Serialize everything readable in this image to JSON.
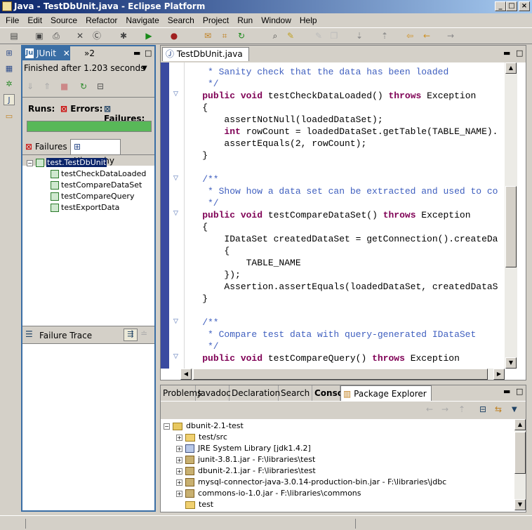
{
  "window": {
    "title": "Java - TestDbUnit.java - Eclipse Platform"
  },
  "menu": [
    "File",
    "Edit",
    "Source",
    "Refactor",
    "Navigate",
    "Search",
    "Project",
    "Run",
    "Window",
    "Help"
  ],
  "junit": {
    "tab_label": "JUnit",
    "overflow_label": "»2",
    "status": "Finished after 1.203 seconds",
    "runs_label": "Runs:",
    "errors_label": "Errors:",
    "failures_label": "Failures:",
    "progress_fraction": 1.0,
    "progress_color": "#58b858",
    "tabs": [
      "Failures",
      "Hierarchy"
    ],
    "tree_root": "test.TestDbUnit",
    "tests": [
      "testCheckDataLoaded",
      "testCompareDataSet",
      "testCompareQuery",
      "testExportData"
    ],
    "failure_trace_label": "Failure Trace"
  },
  "editor": {
    "tab_label": "TestDbUnit.java",
    "lines": [
      [
        {
          "t": "     * Sanity check that the data has been loaded",
          "c": "cmt"
        }
      ],
      [
        {
          "t": "     */",
          "c": "cmt"
        }
      ],
      [
        {
          "t": "    ",
          "c": ""
        },
        {
          "t": "public void",
          "c": "kw"
        },
        {
          "t": " testCheckDataLoaded() ",
          "c": ""
        },
        {
          "t": "throws",
          "c": "kw"
        },
        {
          "t": " Exception",
          "c": ""
        }
      ],
      [
        {
          "t": "    {",
          "c": ""
        }
      ],
      [
        {
          "t": "        assertNotNull(loadedDataSet);",
          "c": ""
        }
      ],
      [
        {
          "t": "        ",
          "c": ""
        },
        {
          "t": "int",
          "c": "kw"
        },
        {
          "t": " rowCount = loadedDataSet.getTable(TABLE_NAME).",
          "c": ""
        }
      ],
      [
        {
          "t": "        assertEquals(2, rowCount);",
          "c": ""
        }
      ],
      [
        {
          "t": "    }",
          "c": ""
        }
      ],
      [
        {
          "t": "",
          "c": ""
        }
      ],
      [
        {
          "t": "    /**",
          "c": "cmt"
        }
      ],
      [
        {
          "t": "     * Show how a data set can be extracted and used to co",
          "c": "cmt"
        }
      ],
      [
        {
          "t": "     */",
          "c": "cmt"
        }
      ],
      [
        {
          "t": "    ",
          "c": ""
        },
        {
          "t": "public void",
          "c": "kw"
        },
        {
          "t": " testCompareDataSet() ",
          "c": ""
        },
        {
          "t": "throws",
          "c": "kw"
        },
        {
          "t": " Exception",
          "c": ""
        }
      ],
      [
        {
          "t": "    {",
          "c": ""
        }
      ],
      [
        {
          "t": "        IDataSet createdDataSet = getConnection().createDa",
          "c": ""
        }
      ],
      [
        {
          "t": "        {",
          "c": ""
        }
      ],
      [
        {
          "t": "            TABLE_NAME",
          "c": ""
        }
      ],
      [
        {
          "t": "        });",
          "c": ""
        }
      ],
      [
        {
          "t": "        Assertion.assertEquals(loadedDataSet, createdDataS",
          "c": ""
        }
      ],
      [
        {
          "t": "    }",
          "c": ""
        }
      ],
      [
        {
          "t": "",
          "c": ""
        }
      ],
      [
        {
          "t": "    /**",
          "c": "cmt"
        }
      ],
      [
        {
          "t": "     * Compare test data with query-generated IDataSet",
          "c": "cmt"
        }
      ],
      [
        {
          "t": "     */",
          "c": "cmt"
        }
      ],
      [
        {
          "t": "    ",
          "c": ""
        },
        {
          "t": "public void",
          "c": "kw"
        },
        {
          "t": " testCompareQuery() ",
          "c": ""
        },
        {
          "t": "throws",
          "c": "kw"
        },
        {
          "t": " Exception",
          "c": ""
        }
      ]
    ]
  },
  "bottom": {
    "tabs": [
      "Problems",
      "Javadoc",
      "Declaration",
      "Search",
      "Console",
      "Package Explorer"
    ],
    "project": "dbunit-2.1-test",
    "entries": [
      {
        "label": "test/src",
        "icon": "package-folder-icon"
      },
      {
        "label": "JRE System Library [jdk1.4.2]",
        "icon": "library-icon"
      },
      {
        "label": "junit-3.8.1.jar - F:\\libraries\\test",
        "icon": "jar-icon"
      },
      {
        "label": "dbunit-2.1.jar - F:\\libraries\\test",
        "icon": "jar-icon"
      },
      {
        "label": "mysql-connector-java-3.0.14-production-bin.jar - F:\\libraries\\jdbc",
        "icon": "jar-icon"
      },
      {
        "label": "commons-io-1.0.jar - F:\\libraries\\commons",
        "icon": "jar-icon"
      },
      {
        "label": "test",
        "icon": "folder-icon"
      }
    ]
  }
}
